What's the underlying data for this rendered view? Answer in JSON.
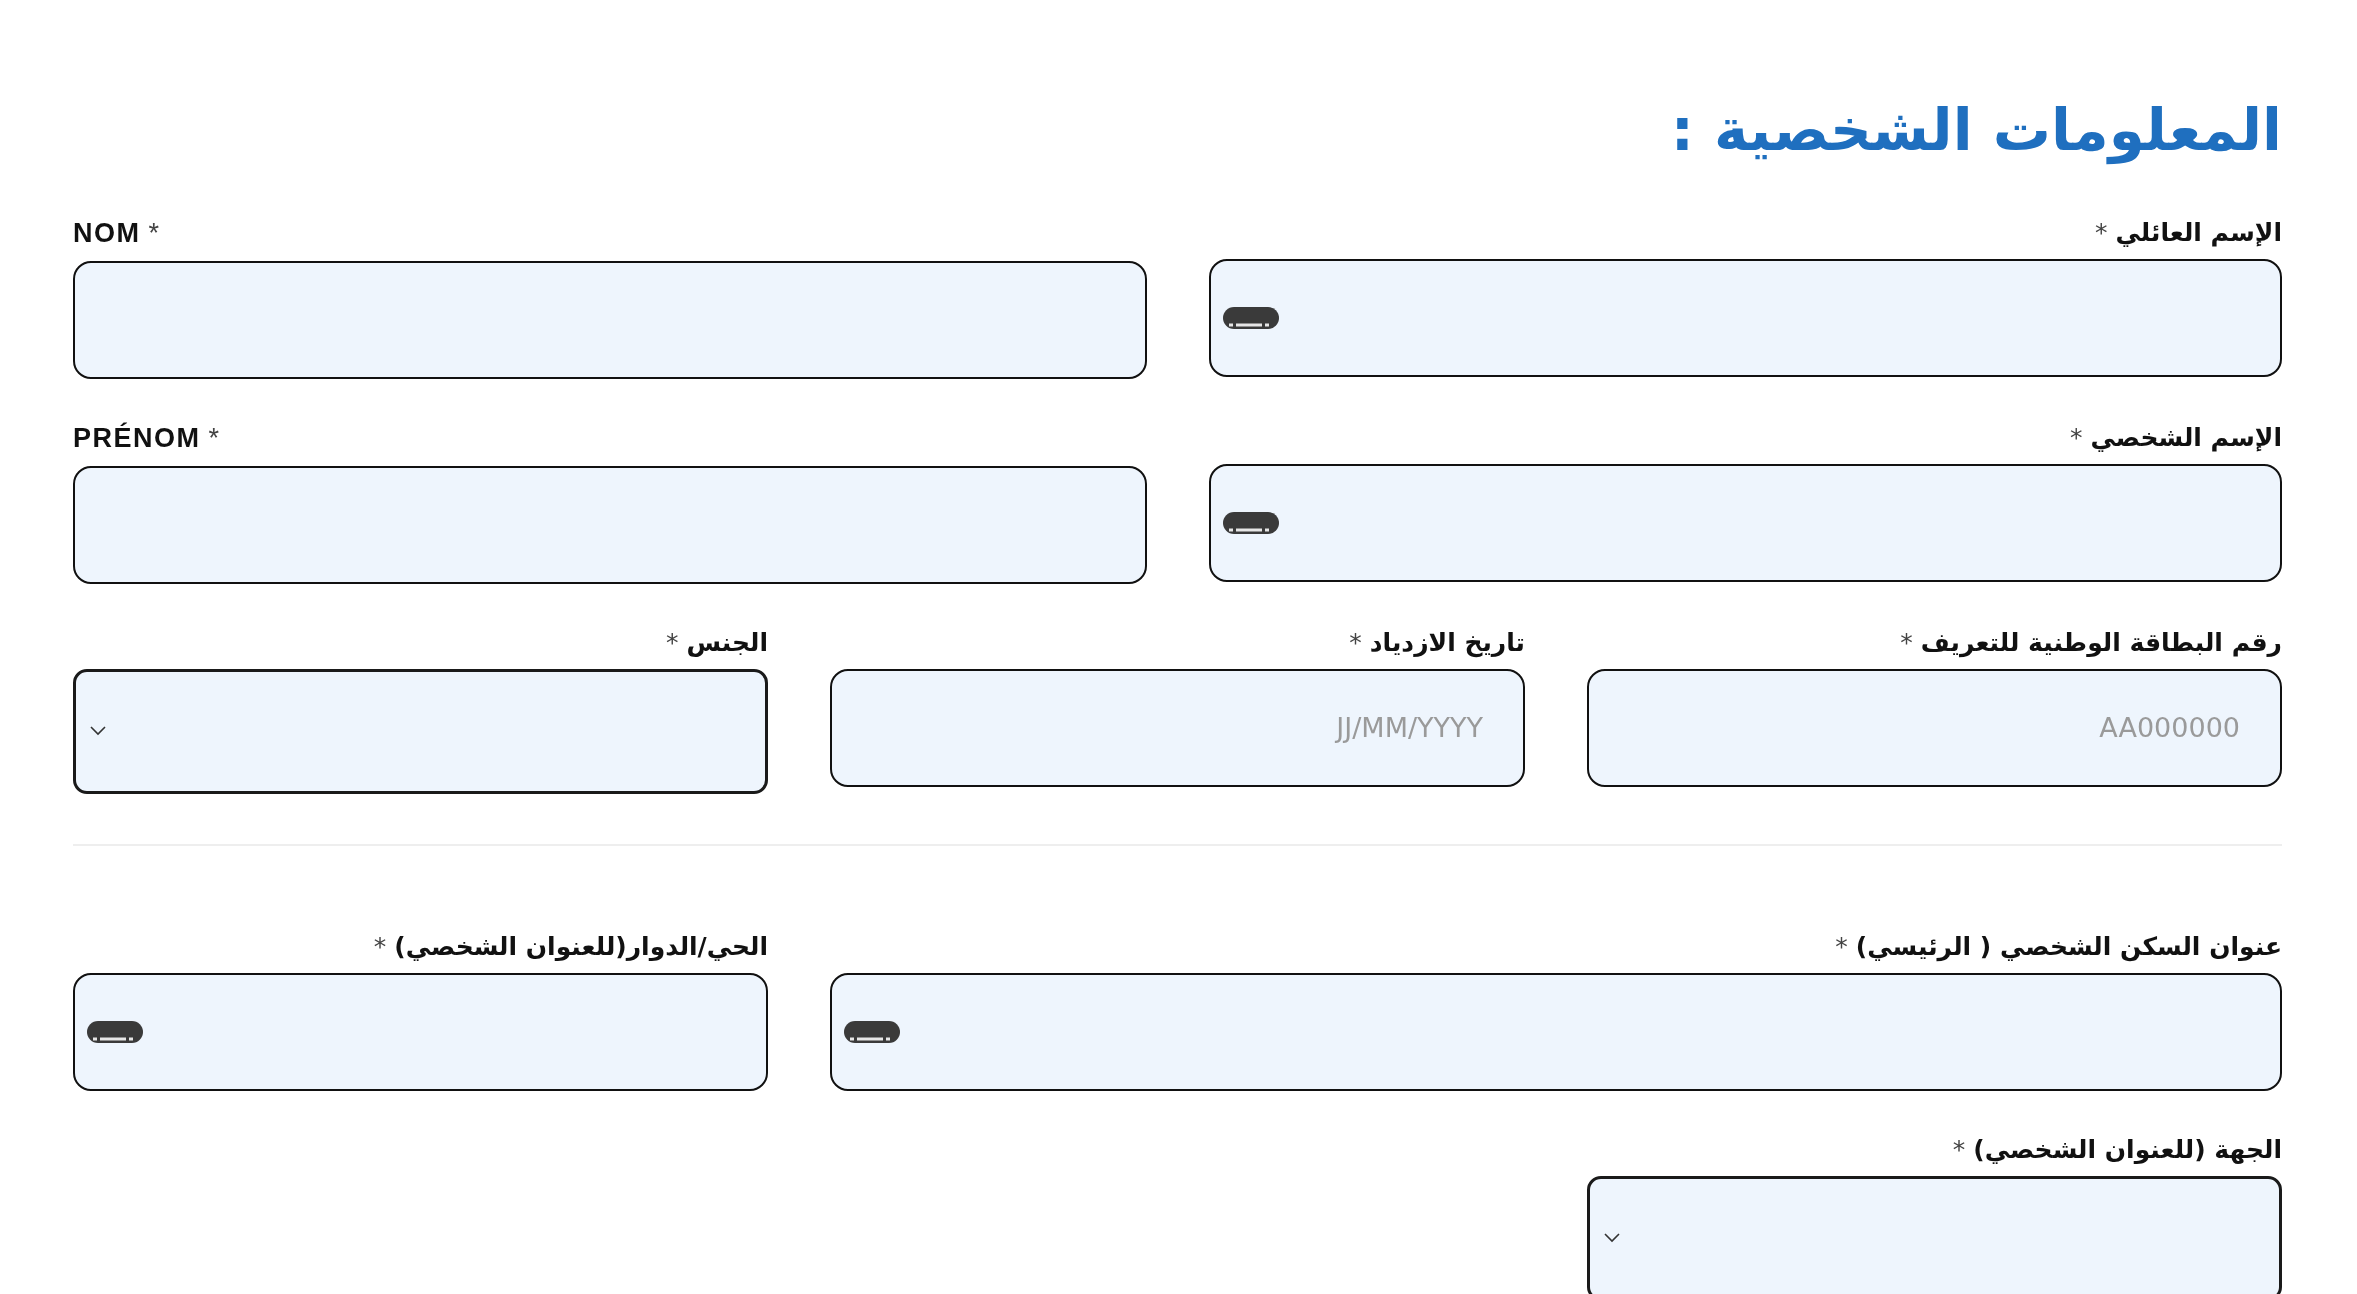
{
  "title": "المعلومات الشخصية :",
  "sections": [
    {
      "rows": [
        {
          "fields": [
            {
              "label": "الإسم العائلي",
              "required_mark": "*",
              "kind": "text",
              "ltr": false,
              "wide": false,
              "keyboard_icon": true
            },
            {
              "label": "NOM",
              "required_mark": "*",
              "kind": "text",
              "ltr": true,
              "wide": false,
              "keyboard_icon": false
            }
          ]
        },
        {
          "fields": [
            {
              "label": "الإسم الشخصي",
              "required_mark": "*",
              "kind": "text",
              "ltr": false,
              "wide": false,
              "keyboard_icon": true
            },
            {
              "label": "PRÉNOM",
              "required_mark": "*",
              "kind": "text",
              "ltr": true,
              "wide": false,
              "keyboard_icon": false
            }
          ]
        },
        {
          "fields": [
            {
              "label": "رقم البطاقة الوطنية للتعريف",
              "required_mark": "*",
              "kind": "text",
              "ltr": false,
              "wide": false,
              "keyboard_icon": false,
              "placeholder": "AA000000"
            },
            {
              "label": "تاريخ الازدياد",
              "required_mark": "*",
              "kind": "text",
              "ltr": false,
              "wide": false,
              "keyboard_icon": false,
              "placeholder": "JJ/MM/YYYY"
            },
            {
              "label": "الجنس",
              "required_mark": "*",
              "kind": "select",
              "ltr": false,
              "wide": false
            }
          ]
        }
      ]
    },
    {
      "rows": [
        {
          "fields": [
            {
              "label": "عنوان السكن الشخصي ( الرئيسي)",
              "required_mark": "*",
              "kind": "text",
              "ltr": false,
              "wide": true,
              "keyboard_icon": true
            },
            {
              "label": "الحي/الدوار(للعنوان الشخصي)",
              "required_mark": "*",
              "kind": "text",
              "ltr": false,
              "wide": false,
              "keyboard_icon": true
            }
          ]
        },
        {
          "fields": [
            {
              "label": "الجهة (للعنوان الشخصي)",
              "required_mark": "*",
              "kind": "select",
              "ltr": false,
              "wide": false
            }
          ]
        }
      ]
    }
  ]
}
